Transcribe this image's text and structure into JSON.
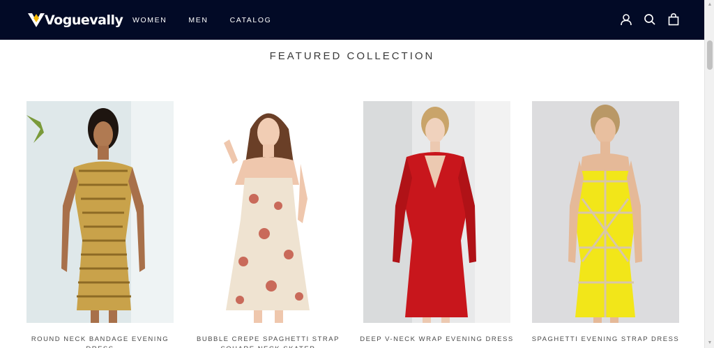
{
  "header": {
    "brand": "Voguevally",
    "nav": [
      {
        "label": "WOMEN"
      },
      {
        "label": "MEN"
      },
      {
        "label": "CATALOG"
      }
    ],
    "icons": [
      "account-icon",
      "search-icon",
      "cart-icon"
    ]
  },
  "colors": {
    "header_bg": "#020a26",
    "logo_accent": "#f5b800"
  },
  "main": {
    "section_title": "FEATURED COLLECTION",
    "products": [
      {
        "title": "ROUND NECK BANDAGE EVENING DRESS",
        "dress_color": "#c9a24a"
      },
      {
        "title": "BUBBLE CREPE SPAGHETTI STRAP SQUARE NECK SKATER",
        "dress_color": "#efe3d1"
      },
      {
        "title": "DEEP V-NECK WRAP EVENING DRESS",
        "dress_color": "#c8161c"
      },
      {
        "title": "SPAGHETTI EVENING STRAP DRESS",
        "dress_color": "#f2e619"
      }
    ]
  }
}
